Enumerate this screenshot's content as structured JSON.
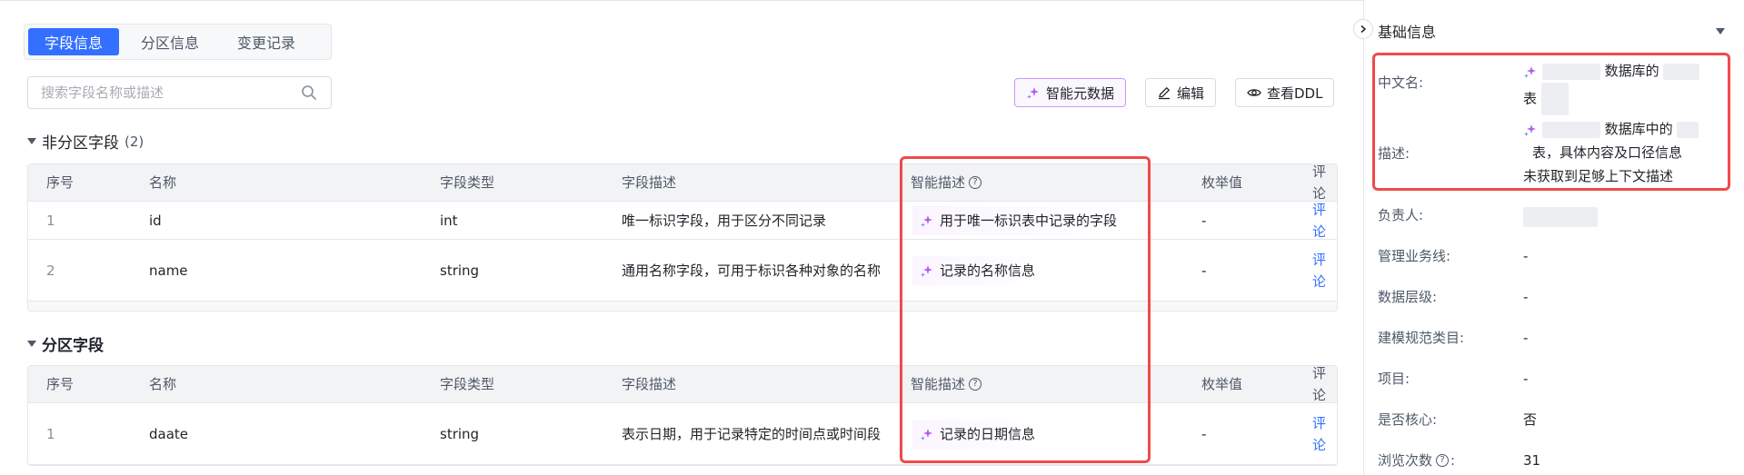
{
  "tabs": [
    {
      "label": "字段信息",
      "active": true
    },
    {
      "label": "分区信息",
      "active": false
    },
    {
      "label": "变更记录",
      "active": false
    }
  ],
  "search": {
    "placeholder": "搜索字段名称或描述"
  },
  "toolbar": {
    "ai_metadata": "智能元数据",
    "edit": "编辑",
    "view_ddl": "查看DDL"
  },
  "sections": {
    "non_partition": {
      "title": "非分区字段",
      "count": "(2)"
    },
    "partition": {
      "title": "分区字段"
    }
  },
  "columns": [
    "序号",
    "名称",
    "字段类型",
    "字段描述",
    "智能描述",
    "枚举值",
    "评论"
  ],
  "non_partition_rows": [
    {
      "index": "1",
      "name": "id",
      "type": "int",
      "desc": "唯一标识字段，用于区分不同记录",
      "ai_desc": "用于唯一标识表中记录的字段",
      "enum": "-",
      "comment": "评论"
    },
    {
      "index": "2",
      "name": "name",
      "type": "string",
      "desc": "通用名称字段，可用于标识各种对象的名称",
      "ai_desc": "记录的名称信息",
      "enum": "-",
      "comment": "评论"
    }
  ],
  "partition_rows": [
    {
      "index": "1",
      "name": "daate",
      "type": "string",
      "desc": "表示日期，用于记录特定的时间点或时间段",
      "ai_desc": "记录的日期信息",
      "enum": "-",
      "comment": "评论"
    }
  ],
  "panel": {
    "title": "基础信息",
    "fields": {
      "cn_name": {
        "label": "中文名:",
        "value_a": "数据库的",
        "value_b": "表"
      },
      "description": {
        "label": "描述:",
        "value_a": "数据库中的",
        "value_b": "表，具体内容及口径信息",
        "value_c": "未获取到足够上下文描述"
      },
      "owner": {
        "label": "负责人:",
        "value": ""
      },
      "business_line": {
        "label": "管理业务线:",
        "value": "-"
      },
      "data_layer": {
        "label": "数据层级:",
        "value": "-"
      },
      "modeling_category": {
        "label": "建模规范类目:",
        "value": "-"
      },
      "project": {
        "label": "项目:",
        "value": "-"
      },
      "is_core": {
        "label": "是否核心:",
        "value": "否"
      },
      "views": {
        "label": "浏览次数",
        "value": "31"
      }
    }
  },
  "colors": {
    "accent": "#3370ff",
    "highlight": "#f04a4a",
    "ai": "#b45cf0"
  }
}
